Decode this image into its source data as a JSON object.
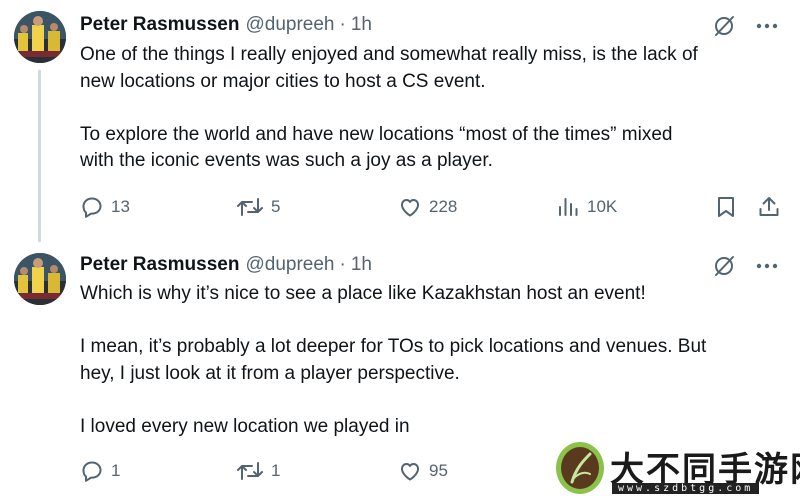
{
  "tweets": [
    {
      "author": {
        "name": "Peter Rasmussen",
        "handle": "@dupreeh",
        "time": "1h"
      },
      "paragraphs": [
        [
          "One of the things I really enjoyed and somewhat really miss, is the lack of",
          "new locations or major cities to host a CS event."
        ],
        [
          "To explore the world and have new locations “most of the times” mixed",
          "with the iconic events was such a joy as a player."
        ]
      ],
      "stats": {
        "replies": "13",
        "reposts": "5",
        "likes": "228",
        "views": "10K"
      }
    },
    {
      "author": {
        "name": "Peter Rasmussen",
        "handle": "@dupreeh",
        "time": "1h"
      },
      "paragraphs": [
        [
          "Which is why it’s nice to see a place like Kazakhstan host an event!"
        ],
        [
          "I mean, it’s probably a lot deeper for TOs to pick locations and venues. But",
          "hey, I just look at it from a player perspective."
        ],
        [
          "I loved every new location we played in"
        ]
      ],
      "stats": {
        "replies": "1",
        "reposts": "1",
        "likes": "95"
      }
    }
  ],
  "icons": {
    "grok": "no-entry-slash-icon",
    "more": "more-dots-icon",
    "reply": "reply-bubble-icon",
    "repost": "repost-icon",
    "like": "heart-icon",
    "views": "views-bars-icon",
    "bookmark": "bookmark-icon",
    "share": "share-icon"
  },
  "colors": {
    "text": "#0f1419",
    "muted": "#536471",
    "thread": "#cfd9de"
  },
  "watermark": {
    "title": "大不同手游网",
    "url": "www.szdbtgg.com"
  }
}
